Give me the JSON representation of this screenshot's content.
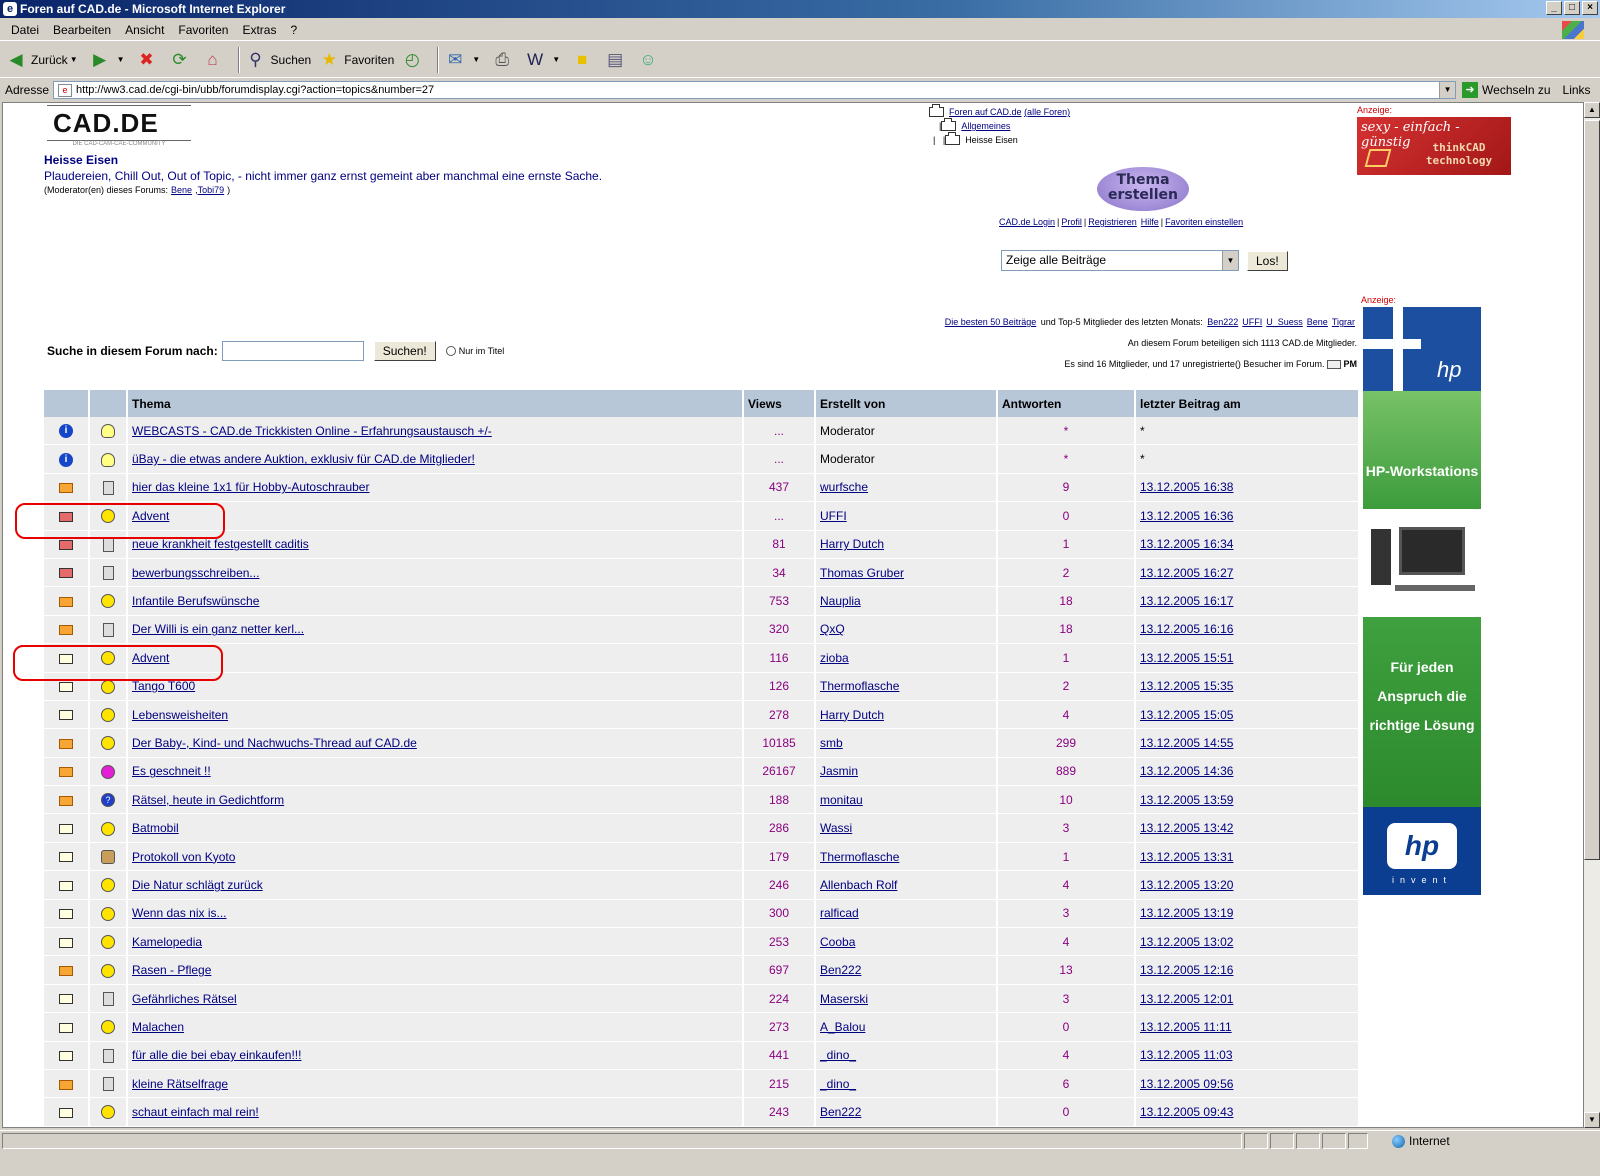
{
  "window": {
    "title": "Foren auf CAD.de - Microsoft Internet Explorer"
  },
  "menu": [
    "Datei",
    "Bearbeiten",
    "Ansicht",
    "Favoriten",
    "Extras",
    "?"
  ],
  "toolbar": {
    "back": "Zurück",
    "search": "Suchen",
    "favorites": "Favoriten"
  },
  "address": {
    "label": "Adresse",
    "url": "http://ww3.cad.de/cgi-bin/ubb/forumdisplay.cgi?action=topics&number=27",
    "go": "Wechseln zu",
    "links": "Links"
  },
  "status": {
    "zone": "Internet"
  },
  "page": {
    "logo": "CAD.DE",
    "logo_sub": "DIE CAD-CAM-CAE-COMMUNITY",
    "forum_title": "Heisse Eisen",
    "forum_desc": "Plaudereien, Chill Out, Out of Topic, - nicht immer ganz ernst gemeint aber manchmal eine ernste Sache.",
    "moderators_label": "(Moderator(en) dieses Forums:",
    "moderators": [
      "Bene",
      "Tobi79"
    ],
    "tree": {
      "root": "Foren auf CAD.de",
      "all": "(alle Foren)",
      "sub": "Allgemeines",
      "current": "Heisse Eisen"
    },
    "new_topic": [
      "Thema",
      "erstellen"
    ],
    "nav": [
      "CAD.de Login",
      "Profil",
      "Registrieren",
      "Hilfe",
      "Favoriten einstellen"
    ],
    "filter": {
      "selected": "Zeige alle Beiträge",
      "button": "Los!"
    },
    "ad_label": "Anzeige:",
    "ad1": {
      "line1": "sexy - einfach - günstig",
      "line2": "thinkCAD technology"
    },
    "ad2": {
      "title": "HP-Workstations",
      "slogan": "Für jeden Anspruch die richtige Lösung",
      "brand": "hp",
      "invent": "invent"
    },
    "stats": {
      "best_link": "Die besten 50 Beiträge",
      "top5_text": "und Top-5 Mitglieder des letzten Monats:",
      "top5": [
        "Ben222",
        "UFFI",
        "U_Suess",
        "Bene",
        "Tigrar"
      ],
      "members": "An diesem Forum beteiligen sich 1113 CAD.de Mitglieder.",
      "online": "Es sind 16 Mitglieder, und 17 unregistrierte() Besucher im Forum.",
      "pm": "PM"
    },
    "search": {
      "label": "Suche in diesem Forum nach:",
      "value": "",
      "button": "Suchen!",
      "radio_label": "Nur im Titel"
    }
  },
  "table": {
    "headers": [
      "Thema",
      "Views",
      "Erstellt von",
      "Antworten",
      "letzter Beitrag am"
    ],
    "rows": [
      {
        "icon": "info",
        "emo": "bulb",
        "title": "WEBCASTS - CAD.de Trickkisten Online - Erfahrungsaustausch +/-",
        "views": "...",
        "author": "Moderator",
        "replies": "*",
        "date": "*"
      },
      {
        "icon": "info",
        "emo": "bulb",
        "title": "üBay - die etwas andere Auktion, exklusiv für CAD.de Mitglieder!",
        "views": "...",
        "author": "Moderator",
        "replies": "*",
        "date": "*"
      },
      {
        "icon": "hot",
        "emo": "doc",
        "title": "hier das kleine 1x1 für Hobby-Autoschrauber",
        "views": "437",
        "author": "wurfsche",
        "replies": "9",
        "date": "13.12.2005 16:38"
      },
      {
        "icon": "red",
        "emo": "smile",
        "title": "Advent",
        "views": "...",
        "author": "UFFI",
        "replies": "0",
        "date": "13.12.2005 16:36"
      },
      {
        "icon": "red",
        "emo": "doc",
        "title": "neue krankheit festgestellt caditis",
        "views": "81",
        "author": "Harry Dutch",
        "replies": "1",
        "date": "13.12.2005 16:34"
      },
      {
        "icon": "red",
        "emo": "doc",
        "title": "bewerbungsschreiben...",
        "views": "34",
        "author": "Thomas Gruber",
        "replies": "2",
        "date": "13.12.2005 16:27"
      },
      {
        "icon": "hot",
        "emo": "smile",
        "title": "Infantile Berufswünsche",
        "views": "753",
        "author": "Nauplia",
        "replies": "18",
        "date": "13.12.2005 16:17"
      },
      {
        "icon": "hot",
        "emo": "doc",
        "title": "Der Willi is ein ganz netter kerl...",
        "views": "320",
        "author": "QxQ",
        "replies": "18",
        "date": "13.12.2005 16:16"
      },
      {
        "icon": "folder",
        "emo": "smile",
        "title": "Advent",
        "views": "116",
        "author": "zioba",
        "replies": "1",
        "date": "13.12.2005 15:51"
      },
      {
        "icon": "folder",
        "emo": "smile",
        "title": "Tango T600",
        "views": "126",
        "author": "Thermoflasche",
        "replies": "2",
        "date": "13.12.2005 15:35"
      },
      {
        "icon": "folder",
        "emo": "smile",
        "title": "Lebensweisheiten",
        "views": "278",
        "author": "Harry Dutch",
        "replies": "4",
        "date": "13.12.2005 15:05"
      },
      {
        "icon": "hot",
        "emo": "smile",
        "title": "Der Baby-, Kind- und Nachwuchs-Thread auf CAD.de",
        "views": "10185",
        "author": "smb",
        "replies": "299",
        "date": "13.12.2005 14:55"
      },
      {
        "icon": "hot",
        "emo": "pink",
        "title": "Es geschneit !!",
        "views": "26167",
        "author": "Jasmin",
        "replies": "889",
        "date": "13.12.2005 14:36"
      },
      {
        "icon": "hot",
        "emo": "q",
        "title": "Rätsel, heute in Gedichtform",
        "views": "188",
        "author": "monitau",
        "replies": "10",
        "date": "13.12.2005 13:59"
      },
      {
        "icon": "folder",
        "emo": "smile",
        "title": "Batmobil",
        "views": "286",
        "author": "Wassi",
        "replies": "3",
        "date": "13.12.2005 13:42"
      },
      {
        "icon": "folder",
        "emo": "other",
        "title": "Protokoll von Kyoto",
        "views": "179",
        "author": "Thermoflasche",
        "replies": "1",
        "date": "13.12.2005 13:31"
      },
      {
        "icon": "folder",
        "emo": "smile",
        "title": "Die Natur schlägt zurück",
        "views": "246",
        "author": "Allenbach Rolf",
        "replies": "4",
        "date": "13.12.2005 13:20"
      },
      {
        "icon": "folder",
        "emo": "smile",
        "title": "Wenn das nix is...",
        "views": "300",
        "author": "ralficad",
        "replies": "3",
        "date": "13.12.2005 13:19"
      },
      {
        "icon": "folder",
        "emo": "smile",
        "title": "Kamelopedia",
        "views": "253",
        "author": "Cooba",
        "replies": "4",
        "date": "13.12.2005 13:02"
      },
      {
        "icon": "hot",
        "emo": "smile",
        "title": "Rasen - Pflege",
        "views": "697",
        "author": "Ben222",
        "replies": "13",
        "date": "13.12.2005 12:16"
      },
      {
        "icon": "folder",
        "emo": "doc",
        "title": "Gefährliches Rätsel",
        "views": "224",
        "author": "Maserski",
        "replies": "3",
        "date": "13.12.2005 12:01"
      },
      {
        "icon": "folder",
        "emo": "smile",
        "title": "Malachen",
        "views": "273",
        "author": "A_Balou",
        "replies": "0",
        "date": "13.12.2005 11:11"
      },
      {
        "icon": "folder",
        "emo": "doc",
        "title": "für alle die bei ebay einkaufen!!!",
        "views": "441",
        "author": "_dino_",
        "replies": "4",
        "date": "13.12.2005 11:03"
      },
      {
        "icon": "hot",
        "emo": "doc",
        "title": "kleine Rätselfrage",
        "views": "215",
        "author": "_dino_",
        "replies": "6",
        "date": "13.12.2005 09:56"
      },
      {
        "icon": "folder",
        "emo": "smile",
        "title": "schaut einfach mal rein!",
        "views": "243",
        "author": "Ben222",
        "replies": "0",
        "date": "13.12.2005 09:43"
      }
    ]
  }
}
